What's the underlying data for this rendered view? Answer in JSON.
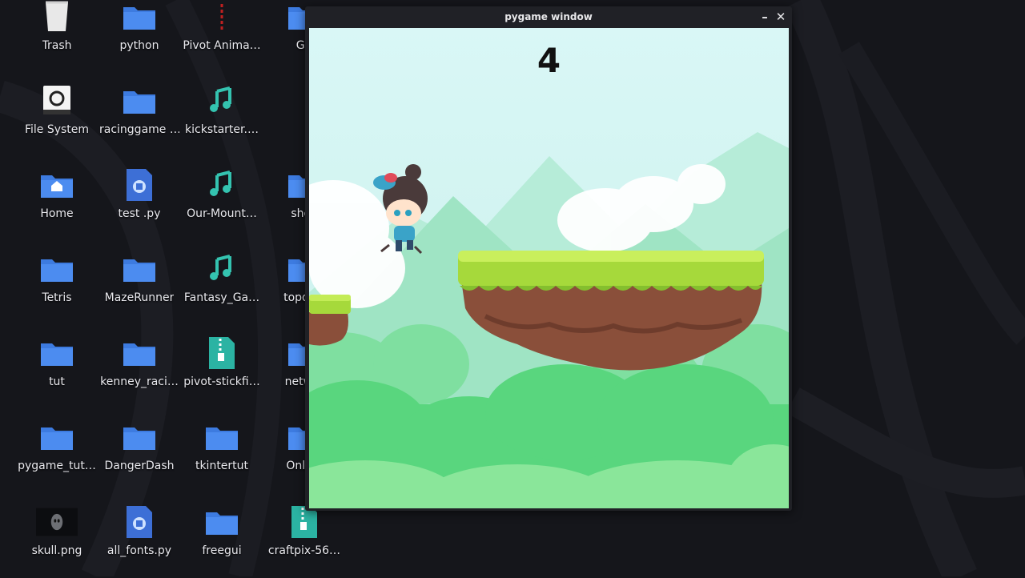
{
  "desktop": {
    "icons": [
      {
        "label": "Trash",
        "icon": "trash-icon"
      },
      {
        "label": "python",
        "icon": "folder-icon"
      },
      {
        "label": "Pivot Anima…",
        "icon": "pivot-app-icon"
      },
      {
        "label": "GC",
        "icon": "folder-icon"
      },
      {
        "label": "File System",
        "icon": "drive-icon"
      },
      {
        "label": "racinggame …",
        "icon": "folder-icon"
      },
      {
        "label": "kickstarter.…",
        "icon": "music-file-icon"
      },
      {
        "label": "Home",
        "icon": "home-folder-icon"
      },
      {
        "label": "test .py",
        "icon": "python-file-icon"
      },
      {
        "label": "Our-Mount…",
        "icon": "music-file-icon"
      },
      {
        "label": "shoo",
        "icon": "folder-icon"
      },
      {
        "label": "Tetris",
        "icon": "folder-icon"
      },
      {
        "label": "MazeRunner",
        "icon": "folder-icon"
      },
      {
        "label": "Fantasy_Ga…",
        "icon": "music-file-icon"
      },
      {
        "label": "topdow",
        "icon": "folder-icon"
      },
      {
        "label": "tut",
        "icon": "folder-icon"
      },
      {
        "label": "kenney_raci…",
        "icon": "folder-icon"
      },
      {
        "label": "pivot-stickfi…",
        "icon": "zip-file-icon"
      },
      {
        "label": "networ",
        "icon": "folder-icon"
      },
      {
        "label": "pygame_tut…",
        "icon": "folder-icon"
      },
      {
        "label": "DangerDash",
        "icon": "folder-icon"
      },
      {
        "label": "tkintertut",
        "icon": "folder-icon"
      },
      {
        "label": "Online",
        "icon": "folder-icon"
      },
      {
        "label": "skull.png",
        "icon": "image-file-icon"
      },
      {
        "label": "all_fonts.py",
        "icon": "python-file-icon"
      },
      {
        "label": "freegui",
        "icon": "folder-icon"
      },
      {
        "label": "craftpix-56…",
        "icon": "zip-file-icon"
      }
    ]
  },
  "window": {
    "title": "pygame window",
    "minimize_glyph": "–",
    "close_glyph": "✕"
  },
  "game": {
    "score": "4"
  },
  "colors": {
    "folder": "#3d7be0",
    "teal": "#34c3b0",
    "sky": "#dff8f5",
    "grass": "#a6d93b",
    "dirt": "#8a4f3a"
  }
}
